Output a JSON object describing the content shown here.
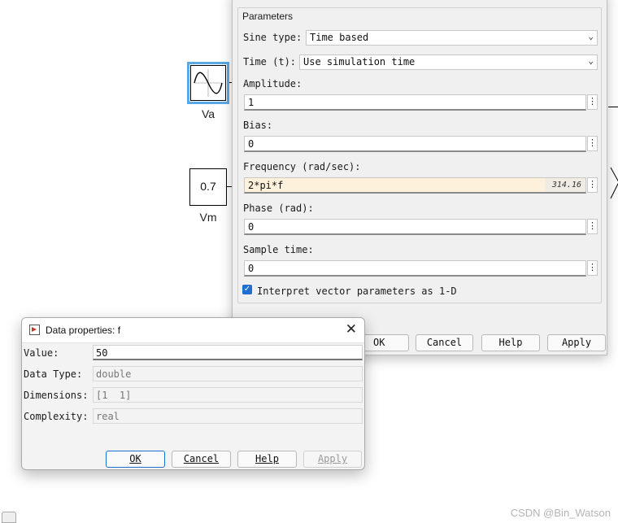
{
  "canvas": {
    "block_va": {
      "label": "Va",
      "icon": "sine-wave-icon"
    },
    "block_vm": {
      "value": "0.7",
      "label": "Vm"
    }
  },
  "param_dialog": {
    "group_title": "Parameters",
    "sine_type": {
      "label": "Sine type:",
      "value": "Time based"
    },
    "time": {
      "label": "Time (t):",
      "value": "Use simulation time"
    },
    "amplitude": {
      "label": "Amplitude:",
      "value": "1"
    },
    "bias": {
      "label": "Bias:",
      "value": "0"
    },
    "frequency": {
      "label": "Frequency (rad/sec):",
      "value": "2*pi*f",
      "evaluated": "314.16"
    },
    "phase": {
      "label": "Phase (rad):",
      "value": "0"
    },
    "sample_time": {
      "label": "Sample time:",
      "value": "0"
    },
    "interpret_vector": {
      "label": "Interpret vector parameters as 1-D",
      "checked": true
    },
    "buttons": {
      "ok": "OK",
      "cancel": "Cancel",
      "help": "Help",
      "apply": "Apply"
    },
    "dots": "⋮"
  },
  "data_dialog": {
    "title": "Data properties: f",
    "close": "✕",
    "value": {
      "label": "Value:",
      "value": "50"
    },
    "data_type": {
      "label": "Data Type:",
      "value": "double"
    },
    "dimensions": {
      "label": "Dimensions:",
      "value": "[1  1]"
    },
    "complexity": {
      "label": "Complexity:",
      "value": "real"
    },
    "buttons": {
      "ok": "OK",
      "cancel": "Cancel",
      "help": "Help",
      "apply": "Apply"
    }
  },
  "watermark": "CSDN @Bin_Watson",
  "accent_color": "#1f6fd1"
}
